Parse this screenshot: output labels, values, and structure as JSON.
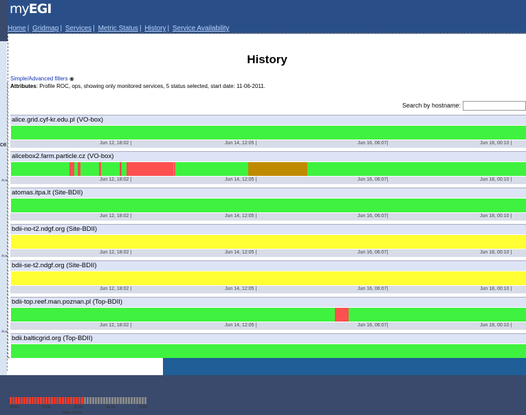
{
  "colors": {
    "ok": "#3ff23f",
    "warning": "#ffff33",
    "critical": "#ff5050",
    "unknown": "#c08a00",
    "header": "#2a4f88",
    "link": "#bcd4ff"
  },
  "app": {
    "logo_prefix": "my",
    "logo_name": "EGI"
  },
  "nav": {
    "items": [
      "Home",
      "Gridmap",
      "Services",
      "Metric Status",
      "History",
      "Service Availability"
    ]
  },
  "page": {
    "title": "History",
    "filters_link": "Simple/Advanced filters",
    "eye_icon": "eye-icon",
    "attributes_label": "Attributes",
    "attributes_text": ": Profile ROC, ops, showing only monitored services, 5 status selected, start date: 11-06-2011.",
    "search_label": "Search by hostname:",
    "search_value": ""
  },
  "ticks": [
    "Jun 12, 18:02 |",
    "Jun 14, 12:05 |",
    "Jun 16, 06:07|",
    "Jun 18, 00:10 |"
  ],
  "hosts": [
    {
      "name": "alice.grid.cyf-kr.edu.pl (VO-box)",
      "segments": [
        [
          "ok",
          100
        ]
      ]
    },
    {
      "name": "alicebox2.farm.particle.cz (VO-box)",
      "segments": [
        [
          "ok",
          11.3
        ],
        [
          "critical",
          1
        ],
        [
          "ok",
          0.6
        ],
        [
          "critical",
          0.5
        ],
        [
          "ok",
          3.6
        ],
        [
          "critical",
          0.5
        ],
        [
          "ok",
          3.6
        ],
        [
          "critical",
          0.4
        ],
        [
          "ok",
          0.9
        ],
        [
          "critical",
          8.6
        ],
        [
          "critical",
          0.4
        ],
        [
          "ok",
          0.2
        ],
        [
          "critical",
          0.2
        ],
        [
          "ok",
          14.2
        ],
        [
          "unknown",
          11.5
        ],
        [
          "ok",
          42.5
        ]
      ]
    },
    {
      "name": "atomas.itpa.lt (Site-BDII)",
      "segments": [
        [
          "ok",
          100
        ]
      ]
    },
    {
      "name": "bdii-no-t2.ndgf.org (Site-BDII)",
      "segments": [
        [
          "warning",
          100
        ]
      ]
    },
    {
      "name": "bdii-se-t2.ndgf.org (Site-BDII)",
      "segments": [
        [
          "warning",
          100
        ]
      ]
    },
    {
      "name": "bdii-top.reef.man.poznan.pl (Top-BDII)",
      "segments": [
        [
          "ok",
          62.8
        ],
        [
          "critical",
          2.7
        ],
        [
          "ok",
          34.5
        ]
      ]
    },
    {
      "name": "bdii.balticgrid.org (Top-BDII)",
      "segments": [
        [
          "ok",
          100
        ]
      ]
    }
  ],
  "background": {
    "left_label": "ce",
    "axis_labels": [
      "18-05",
      "25-05",
      "01-06",
      "08-06",
      "15-06"
    ],
    "axis_title": "Dates dd-mm",
    "zero_label": "0%",
    "vertical_label": "Availability"
  }
}
